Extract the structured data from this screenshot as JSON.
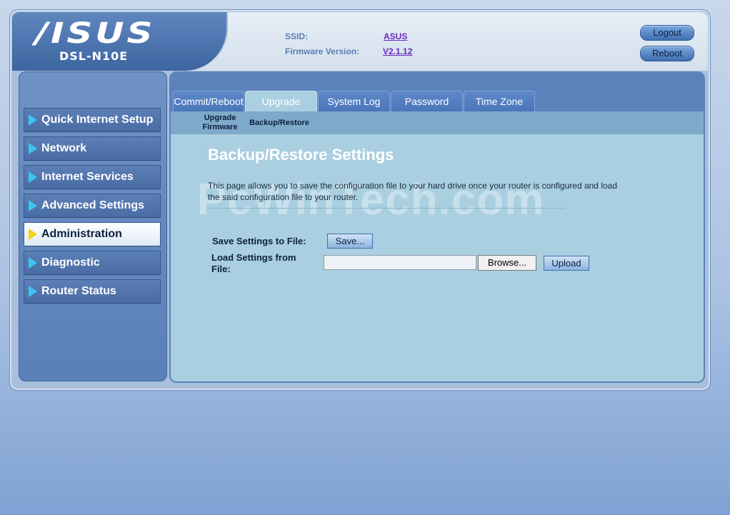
{
  "header": {
    "brand": "/ISUS",
    "model": "DSL-N10E",
    "ssid_label": "SSID:",
    "ssid_value": "ASUS",
    "firmware_label": "Firmware Version:",
    "firmware_value": "V2.1.12",
    "logout_label": "Logout",
    "reboot_label": "Reboot"
  },
  "sidebar": {
    "items": [
      {
        "label": "Quick Internet Setup"
      },
      {
        "label": "Network"
      },
      {
        "label": "Internet Services"
      },
      {
        "label": "Advanced Settings"
      },
      {
        "label": "Administration",
        "active": true
      },
      {
        "label": "Diagnostic"
      },
      {
        "label": "Router Status"
      }
    ]
  },
  "tabs": [
    {
      "label": "Commit/Reboot"
    },
    {
      "label": "Upgrade",
      "active": true
    },
    {
      "label": "System Log"
    },
    {
      "label": "Password"
    },
    {
      "label": "Time Zone"
    }
  ],
  "subtabs": [
    {
      "label_line1": "Upgrade",
      "label_line2": "Firmware"
    },
    {
      "label": "Backup/Restore",
      "active": true
    }
  ],
  "main": {
    "watermark": "PcWinTech.com",
    "title": "Backup/Restore Settings",
    "description": "This page allows you to save the configuration file to your hard drive once your router is configured and load the said configuration file to your router.",
    "save_label": "Save Settings to File:",
    "save_button": "Save...",
    "load_label_line1": "Load Settings from",
    "load_label_line2": "File:",
    "file_value": "",
    "browse_button": "Browse...",
    "upload_button": "Upload"
  },
  "colors": {
    "accent": "#5b82bb",
    "content_bg": "#a9cfe0",
    "arrow": "#39c7f2",
    "active_arrow": "#f2d40f"
  }
}
